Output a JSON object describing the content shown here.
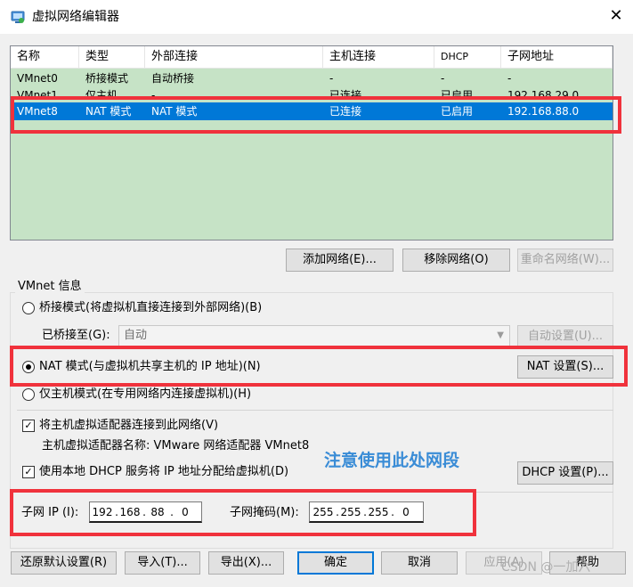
{
  "window": {
    "title": "虚拟网络编辑器",
    "app_icon": "vmware-network-icon",
    "close_icon": "close-icon"
  },
  "table": {
    "headers": [
      "名称",
      "类型",
      "外部连接",
      "主机连接",
      "DHCP",
      "子网地址"
    ],
    "rows": [
      {
        "name": "VMnet0",
        "type": "桥接模式",
        "external": "自动桥接",
        "host": "-",
        "dhcp": "-",
        "subnet": "-"
      },
      {
        "name": "VMnet1",
        "type": "仅主机...",
        "external": "-",
        "host": "已连接",
        "dhcp": "已启用",
        "subnet": "192.168.29.0"
      },
      {
        "name": "VMnet8",
        "type": "NAT 模式",
        "external": "NAT 模式",
        "host": "已连接",
        "dhcp": "已启用",
        "subnet": "192.168.88.0",
        "selected": true
      }
    ]
  },
  "table_buttons": {
    "add": "添加网络(E)...",
    "remove": "移除网络(O)",
    "rename": "重命名网络(W)..."
  },
  "vmnet_info": {
    "group_label": "VMnet 信息",
    "bridge_radio": "桥接模式(将虚拟机直接连接到外部网络)(B)",
    "bridged_to_label": "已桥接至(G):",
    "bridged_to_value": "自动",
    "auto_settings": "自动设置(U)...",
    "nat_radio": "NAT 模式(与虚拟机共享主机的 IP 地址)(N)",
    "nat_settings": "NAT 设置(S)...",
    "hostonly_radio": "仅主机模式(在专用网络内连接虚拟机)(H)",
    "connect_adapter_check": "将主机虚拟适配器连接到此网络(V)",
    "adapter_name": "主机虚拟适配器名称: VMware 网络适配器 VMnet8",
    "dhcp_check": "使用本地 DHCP 服务将 IP 地址分配给虚拟机(D)",
    "dhcp_settings": "DHCP 设置(P)...",
    "subnet_ip_label": "子网 IP (I):",
    "subnet_ip": [
      "192",
      "168",
      "88",
      "0"
    ],
    "subnet_mask_label": "子网掩码(M):",
    "subnet_mask": [
      "255",
      "255",
      "255",
      "0"
    ],
    "selected_mode": "nat"
  },
  "footer_buttons": {
    "restore": "还原默认设置(R)",
    "import": "导入(T)...",
    "export": "导出(X)...",
    "ok": "确定",
    "cancel": "取消",
    "apply": "应用(A)",
    "help": "帮助"
  },
  "annotation": {
    "note": "注意使用此处网段",
    "color": "#f0323c"
  },
  "watermark": "CSDN @一加六",
  "colors": {
    "selection": "#0078d7",
    "table_bg": "#c6e3c6",
    "note": "#3a8cd6"
  }
}
